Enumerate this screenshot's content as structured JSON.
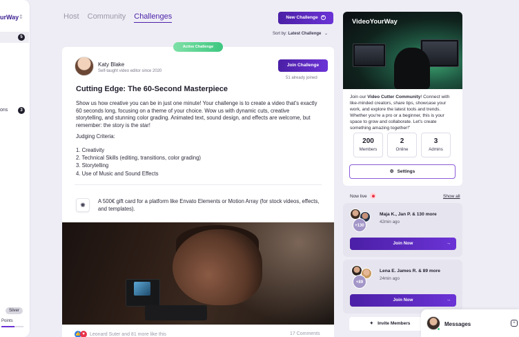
{
  "sidebar": {
    "brand": "urWay",
    "badge_1": "5",
    "badge_2": "3",
    "item_text": "ons",
    "tier": "Silver",
    "points_label": "Points",
    "points_progress": 0.6
  },
  "tabs": [
    "Host",
    "Community",
    "Challenges"
  ],
  "active_tab": "Challenges",
  "toolbar": {
    "new_challenge": "New Challenge",
    "sort_prefix": "Sort by:",
    "sort_value": "Latest Challenge"
  },
  "challenge": {
    "status": "Active Challenge",
    "author_name": "Katy Blake",
    "author_sub": "Self-taught video editor since 2020",
    "join_label": "Join Challenge",
    "joined": "51 already joined",
    "title": "Cutting Edge: The 60-Second Masterpiece",
    "description": "Show us how creative you can be in just one minute! Your challenge is to create a video that's exactly 60 seconds long, focusing on a theme of your choice. Wow us with dynamic cuts, creative storytelling, and stunning color grading. Animated text, sound design, and effects are welcome, but remember: the story is the star!",
    "criteria_title": "Judging Criteria:",
    "criteria": [
      "1.  Creativity",
      "2.  Technical Skills (editing, transitions, color grading)",
      "3.  Storytelling",
      "4.  Use of Music and Sound Effects"
    ],
    "prize": "A 500€ gift card for a platform like Envato Elements or Motion Array (for stock videos, effects, and templates).",
    "likes": "Leonard Suter and 81 more like this",
    "comments": "17 Comments"
  },
  "community": {
    "title": "VideoYourWay",
    "desc_prefix": "Join our ",
    "desc_bold": "Video Cutter Community",
    "desc_suffix": "! Connect with like-minded creators, share tips, showcase your work, and explore the latest tools and trends. Whether you're a pro or a beginner, this is your space to grow and collaborate. Let's create something amazing together!\"",
    "stats": [
      {
        "num": "200",
        "label": "Members"
      },
      {
        "num": "2",
        "label": "Online"
      },
      {
        "num": "3",
        "label": "Admins"
      }
    ],
    "settings": "Settings"
  },
  "now_live": {
    "label": "Now live",
    "show_all": "Show all",
    "sessions": [
      {
        "names": "Maja K., Jan P. & 130 more",
        "time": "42min ago",
        "more": "+130",
        "join": "Join Now"
      },
      {
        "names": "Lena E. James R. & 89 more",
        "time": "24min ago",
        "more": "+89",
        "join": "Join Now"
      }
    ]
  },
  "invite": "Invite Members",
  "messages": "Messages",
  "colors": {
    "accent": "#4b1fa6",
    "active_green": "#3ec780",
    "live_red": "#e8334a"
  }
}
